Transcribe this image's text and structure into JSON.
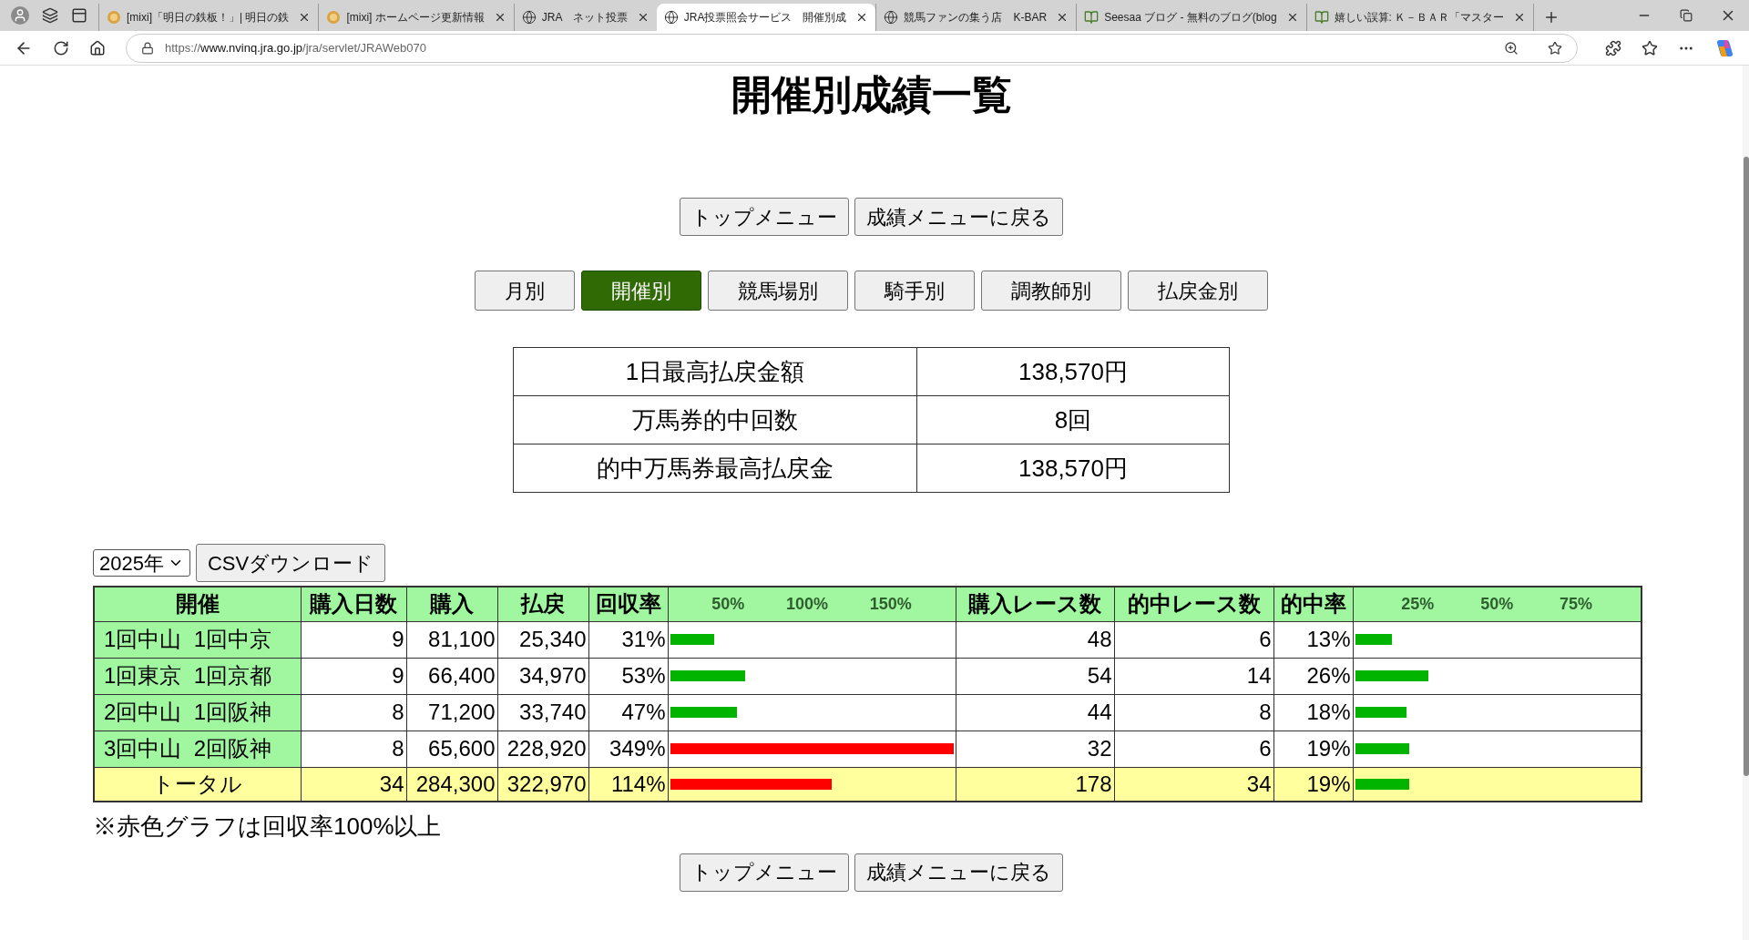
{
  "browser": {
    "tabs": [
      {
        "title": "[mixi]「明日の鉄板！」| 明日の鉄",
        "kind": "mixi",
        "selected": false
      },
      {
        "title": "[mixi] ホームページ更新情報",
        "kind": "mixi",
        "selected": false
      },
      {
        "title": "JRA　ネット投票",
        "kind": "globe",
        "selected": false
      },
      {
        "title": "JRA投票照会サービス　開催別成",
        "kind": "globe",
        "selected": true
      },
      {
        "title": "競馬ファンの集う店　K-BAR",
        "kind": "globe",
        "selected": false
      },
      {
        "title": "Seesaa ブログ - 無料のブログ(blog",
        "kind": "book",
        "selected": false
      },
      {
        "title": "嬉しい誤算: Ｋ－ＢＡＲ「マスター",
        "kind": "book",
        "selected": false
      }
    ],
    "address": "https://**www.nvinq.jra.go.jp**/jra/servlet/JRAWeb070"
  },
  "page": {
    "title": "開催別成績一覧",
    "nav_buttons": [
      "トップメニュー",
      "成績メニューに戻る"
    ],
    "tabs": [
      {
        "label": "月別",
        "selected": false
      },
      {
        "label": "開催別",
        "selected": true
      },
      {
        "label": "競馬場別",
        "selected": false
      },
      {
        "label": "騎手別",
        "selected": false
      },
      {
        "label": "調教師別",
        "selected": false
      },
      {
        "label": "払戻金別",
        "selected": false
      }
    ],
    "summary": [
      {
        "label": "1日最高払戻金額",
        "value": "138,570円"
      },
      {
        "label": "万馬券的中回数",
        "value": "8回"
      },
      {
        "label": "的中万馬券最高払戻金",
        "value": "138,570円"
      }
    ],
    "year_select": "2025年",
    "csv_button": "CSVダウンロード",
    "table": {
      "columns": [
        "開催",
        "購入日数",
        "購入",
        "払戻",
        "回収率",
        "購入レース数",
        "的中レース数",
        "的中率"
      ],
      "return_ticks": [
        "50%",
        "100%",
        "150%"
      ],
      "hit_ticks": [
        "25%",
        "50%",
        "75%"
      ],
      "rows": [
        {
          "kind": "race",
          "meeting": "1回中山  1回中京",
          "days": "9",
          "bought": "81,100",
          "payout": "25,340",
          "recovery": "31%",
          "recovery_bar": {
            "level": 0.155,
            "color": "#00b400"
          },
          "races": "48",
          "hits": "6",
          "hit_rate": "13%",
          "hit_bar": {
            "level": 0.13,
            "color": "#00b400"
          }
        },
        {
          "kind": "race",
          "meeting": "1回東京  1回京都",
          "days": "9",
          "bought": "66,400",
          "payout": "34,970",
          "recovery": "53%",
          "recovery_bar": {
            "level": 0.265,
            "color": "#00b400"
          },
          "races": "54",
          "hits": "14",
          "hit_rate": "26%",
          "hit_bar": {
            "level": 0.26,
            "color": "#00b400"
          }
        },
        {
          "kind": "race",
          "meeting": "2回中山  1回阪神",
          "days": "8",
          "bought": "71,200",
          "payout": "33,740",
          "recovery": "47%",
          "recovery_bar": {
            "level": 0.235,
            "color": "#00b400"
          },
          "races": "44",
          "hits": "8",
          "hit_rate": "18%",
          "hit_bar": {
            "level": 0.18,
            "color": "#00b400"
          }
        },
        {
          "kind": "race",
          "meeting": "3回中山  2回阪神",
          "days": "8",
          "bought": "65,600",
          "payout": "228,920",
          "recovery": "349%",
          "recovery_bar": {
            "level": 1,
            "color": "#ff0000"
          },
          "races": "32",
          "hits": "6",
          "hit_rate": "19%",
          "hit_bar": {
            "level": 0.19,
            "color": "#00b400"
          }
        },
        {
          "kind": "total",
          "meeting": "トータル",
          "days": "34",
          "bought": "284,300",
          "payout": "322,970",
          "recovery": "114%",
          "recovery_bar": {
            "level": 0.57,
            "color": "#ff0000"
          },
          "races": "178",
          "hits": "34",
          "hit_rate": "19%",
          "hit_bar": {
            "level": 0.19,
            "color": "#00b400"
          }
        }
      ]
    },
    "note": "※赤色グラフは回収率100%以上",
    "bottom_buttons": [
      "トップメニュー",
      "成績メニューに戻る"
    ]
  }
}
